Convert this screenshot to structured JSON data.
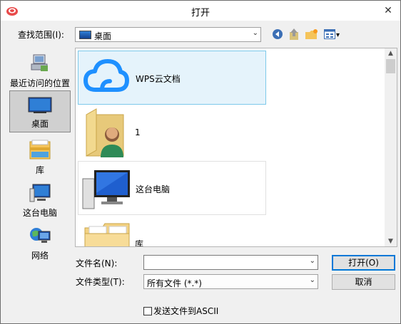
{
  "window": {
    "title": "打开",
    "close_glyph": "✕"
  },
  "lookin": {
    "label": "查找范围(I):",
    "value": "桌面",
    "arrow": "⌄"
  },
  "toolbar": {
    "back_icon": "back-arrow-icon",
    "up_icon": "up-folder-icon",
    "new_folder_icon": "new-folder-icon",
    "view_icon": "view-menu-icon",
    "view_arrow": "▾"
  },
  "places": [
    {
      "label": "最近访问的位置",
      "icon": "recent-places-icon"
    },
    {
      "label": "桌面",
      "icon": "desktop-icon",
      "selected": true
    },
    {
      "label": "库",
      "icon": "libraries-icon"
    },
    {
      "label": "这台电脑",
      "icon": "this-pc-icon"
    },
    {
      "label": "网络",
      "icon": "network-icon"
    }
  ],
  "files": [
    {
      "name": "WPS云文档",
      "icon": "cloud-icon",
      "selected": true
    },
    {
      "name": "1",
      "icon": "user-folder-icon"
    },
    {
      "name": "这台电脑",
      "icon": "computer-icon"
    },
    {
      "name": "库",
      "icon": "library-folder-icon"
    }
  ],
  "scroll": {
    "up": "▲",
    "down": "▼"
  },
  "filename": {
    "label": "文件名(N):",
    "value": "",
    "placeholder": ""
  },
  "filetype": {
    "label": "文件类型(T):",
    "value": "所有文件 (*.*)"
  },
  "buttons": {
    "open": "打开(O)",
    "cancel": "取消"
  },
  "checkbox": {
    "label": "发送文件到ASCII",
    "checked": false
  },
  "colors": {
    "accent": "#0078d7",
    "cloud": "#1e90ff",
    "selection": "#e5f3fb"
  }
}
